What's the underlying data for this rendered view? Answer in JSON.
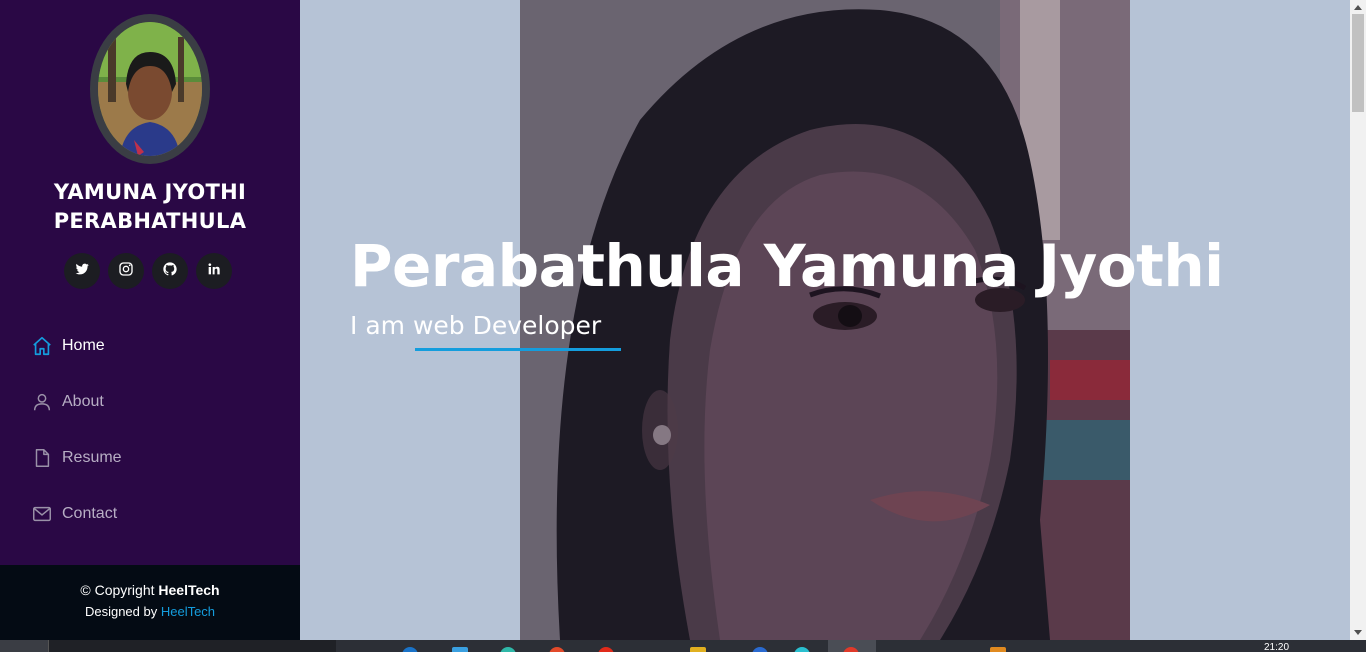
{
  "sidebar": {
    "name_line1": "YAMUNA JYOTHI",
    "name_line2": "PERABHATHULA",
    "socials": [
      {
        "icon": "twitter-icon"
      },
      {
        "icon": "instagram-icon"
      },
      {
        "icon": "github-icon"
      },
      {
        "icon": "linkedin-icon"
      }
    ],
    "nav": [
      {
        "label": "Home",
        "icon": "home-icon",
        "active": true
      },
      {
        "label": "About",
        "icon": "user-icon",
        "active": false
      },
      {
        "label": "Resume",
        "icon": "file-icon",
        "active": false
      },
      {
        "label": "Contact",
        "icon": "envelope-icon",
        "active": false
      }
    ],
    "footer": {
      "copyright_prefix": "© Copyright ",
      "copyright_brand": "HeelTech",
      "designed_prefix": "Designed by ",
      "designed_brand": "HeelTech"
    }
  },
  "hero": {
    "title": "Perabathula Yamuna Jyothi",
    "subtitle": "I am web Developer"
  },
  "taskbar": {
    "clock": "21:20"
  },
  "colors": {
    "sidebar_bg": "#2a0845",
    "footer_bg": "#040b14",
    "accent": "#149ddd",
    "hero_bg": "#b6c3d6"
  }
}
